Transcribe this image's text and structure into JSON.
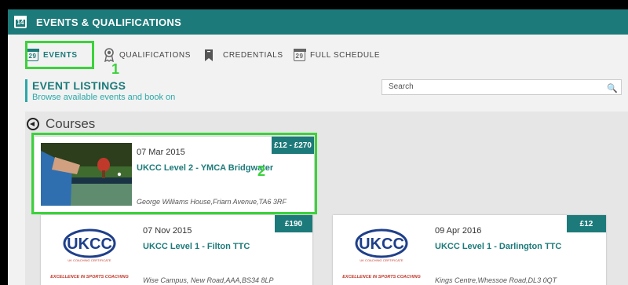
{
  "header": {
    "title": "EVENTS & QUALIFICATIONS",
    "icon": "calendar-icon",
    "icon_day": "14"
  },
  "tabs": [
    {
      "label": "EVENTS",
      "icon": "calendar-icon",
      "icon_day": "29",
      "active": true
    },
    {
      "label": "QUALIFICATIONS",
      "icon": "award-icon",
      "active": false
    },
    {
      "label": "CREDENTIALS",
      "icon": "bookmark-icon",
      "active": false
    },
    {
      "label": "FULL SCHEDULE",
      "icon": "calendar-icon",
      "icon_day": "29",
      "active": false
    }
  ],
  "listing": {
    "title": "EVENT LISTINGS",
    "subtitle": "Browse available events and book on"
  },
  "search": {
    "placeholder": "Search"
  },
  "section": {
    "title": "Courses"
  },
  "annotations": {
    "one": "1",
    "two": "2"
  },
  "events": [
    {
      "date": "07 Mar 2015",
      "name": "UKCC Level 2 - YMCA Bridgwater",
      "location": "George Williams House,Friarn Avenue,TA6 3RF",
      "price": "£12 - £270"
    },
    {
      "date": "07 Nov 2015",
      "name": "UKCC Level 1 - Filton TTC",
      "location": "Wise Campus, New Road,AAA,BS34 8LP",
      "price": "£190"
    },
    {
      "date": "09 Apr 2016",
      "name": "UKCC Level 1 - Darlington TTC",
      "location": "Kings Centre,Whessoe Road,DL3 0QT",
      "price": "£12"
    }
  ],
  "logo": {
    "text": "UKCC",
    "tagline": "UK COACHING CERTIFICATE",
    "strap": "EXCELLENCE IN SPORTS COACHING"
  },
  "colors": {
    "teal": "#1d7a7a",
    "highlight": "#3bd23b"
  }
}
